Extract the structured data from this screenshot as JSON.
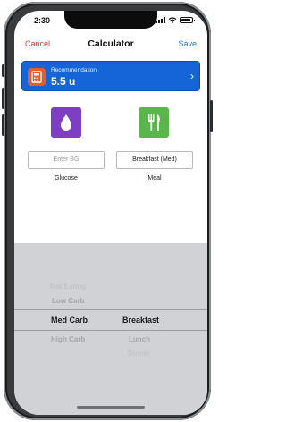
{
  "status": {
    "time": "2:30"
  },
  "nav": {
    "cancel": "Cancel",
    "title": "Calculator",
    "save": "Save"
  },
  "recommendation": {
    "label": "Recommendation",
    "value": "5.5 u"
  },
  "glucose": {
    "placeholder": "Enter BG",
    "caption": "Glucose"
  },
  "meal": {
    "value": "Breakfast (Med)",
    "caption": "Meal"
  },
  "picker": {
    "carb_options": [
      "Not Eating",
      "Low Carb",
      "Med Carb",
      "High Carb"
    ],
    "meal_options": [
      "Breakfast",
      "Lunch",
      "Dinner"
    ],
    "selected_carb": "Med Carb",
    "selected_meal": "Breakfast"
  },
  "colors": {
    "cancel": "#e0342b",
    "save": "#1f6fd0",
    "recommendation_bg": "#1565d8",
    "calculator_icon": "#ea5b2a",
    "glucose_tile": "#7e3ec2",
    "meal_tile": "#58b64b"
  },
  "icons": {
    "recommendation": "calculator-icon",
    "glucose": "blood-drop-icon",
    "meal": "fork-knife-icon",
    "chevron": "chevron-right-icon"
  }
}
